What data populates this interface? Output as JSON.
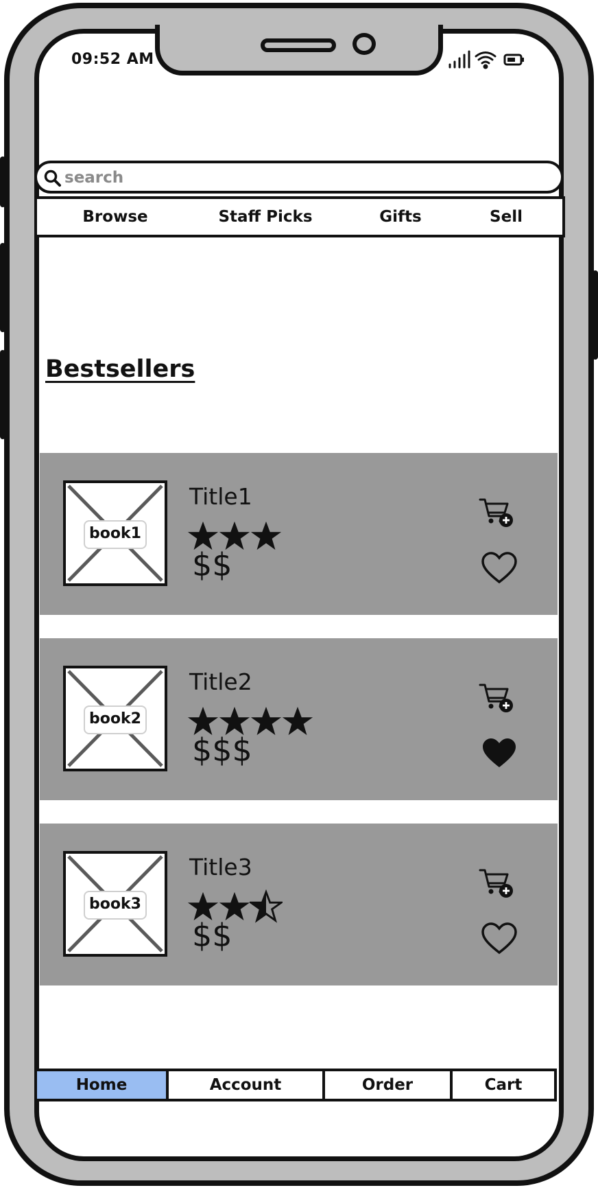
{
  "status_bar": {
    "time": "09:52 AM",
    "icons": [
      "signal-icon",
      "wifi-icon",
      "battery-icon"
    ]
  },
  "search": {
    "placeholder": "search",
    "value": ""
  },
  "top_nav": [
    "Browse",
    "Staff Picks",
    "Gifts",
    "Sell"
  ],
  "section_heading": "Bestsellers",
  "books": [
    {
      "cover_label": "book1",
      "title": "Title1",
      "rating": 3,
      "price": "$$",
      "favorited": false
    },
    {
      "cover_label": "book2",
      "title": "Title2",
      "rating": 4,
      "price": "$$$",
      "favorited": true
    },
    {
      "cover_label": "book3",
      "title": "Title3",
      "rating": 2.5,
      "price": "$$",
      "favorited": false
    }
  ],
  "bottom_tabs": [
    {
      "label": "Home",
      "active": true
    },
    {
      "label": "Account",
      "active": false
    },
    {
      "label": "Order",
      "active": false
    },
    {
      "label": "Cart",
      "active": false
    }
  ],
  "colors": {
    "card_bg": "#999999",
    "active_tab": "#99bdf2",
    "frame": "#bdbdbd"
  }
}
